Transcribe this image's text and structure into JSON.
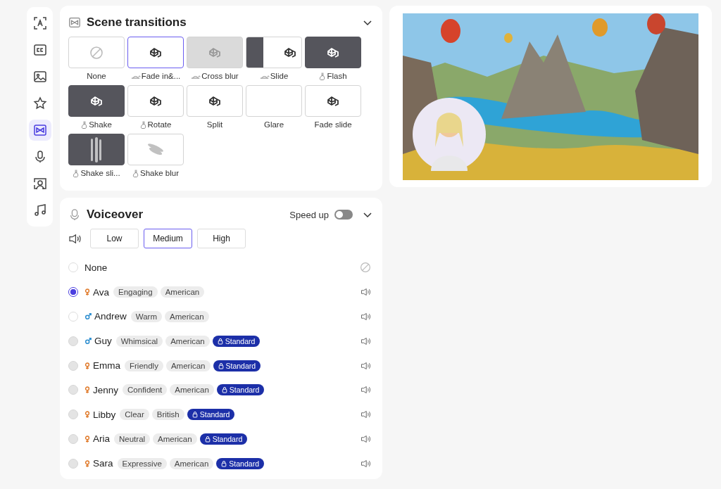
{
  "sidebar": {
    "items": [
      {
        "selected": false
      },
      {
        "selected": false
      },
      {
        "selected": false
      },
      {
        "selected": false
      },
      {
        "selected": true
      },
      {
        "selected": false
      },
      {
        "selected": false
      },
      {
        "selected": false
      }
    ]
  },
  "transitions": {
    "title": "Scene transitions",
    "expanded": true,
    "items": [
      {
        "label": "None",
        "kind": "none",
        "slow": false,
        "fast": false,
        "selected": false
      },
      {
        "label": "Fade in&...",
        "kind": "plain",
        "slow": true,
        "fast": false,
        "selected": true
      },
      {
        "label": "Cross blur",
        "kind": "grey",
        "slow": true,
        "fast": false,
        "selected": false
      },
      {
        "label": "Slide",
        "kind": "slide",
        "slow": true,
        "fast": false,
        "selected": false
      },
      {
        "label": "Flash",
        "kind": "dark",
        "slow": false,
        "fast": true,
        "selected": false
      },
      {
        "label": "Shake",
        "kind": "dark",
        "slow": false,
        "fast": true,
        "selected": false
      },
      {
        "label": "Rotate",
        "kind": "plain",
        "slow": false,
        "fast": true,
        "selected": false
      },
      {
        "label": "Split",
        "kind": "plain",
        "slow": false,
        "fast": false,
        "selected": false
      },
      {
        "label": "Glare",
        "kind": "empty",
        "slow": false,
        "fast": false,
        "selected": false
      },
      {
        "label": "Fade slide",
        "kind": "plain",
        "slow": false,
        "fast": false,
        "selected": false
      },
      {
        "label": "Shake sli...",
        "kind": "blur-dark",
        "slow": false,
        "fast": true,
        "selected": false
      },
      {
        "label": "Shake blur",
        "kind": "blur-light",
        "slow": false,
        "fast": true,
        "selected": false
      }
    ]
  },
  "voiceover": {
    "title": "Voiceover",
    "speed_up": {
      "label": "Speed up",
      "on": false
    },
    "volume": [
      {
        "label": "Low",
        "selected": false
      },
      {
        "label": "Medium",
        "selected": true
      },
      {
        "label": "High",
        "selected": false
      }
    ],
    "voices": [
      {
        "kind": "none",
        "name": "None",
        "selected": false,
        "disabled": false
      },
      {
        "kind": "female",
        "name": "Ava",
        "tags": [
          "Engaging",
          "American"
        ],
        "locked": false,
        "selected": true,
        "disabled": false
      },
      {
        "kind": "male",
        "name": "Andrew",
        "tags": [
          "Warm",
          "American"
        ],
        "locked": false,
        "selected": false,
        "disabled": false
      },
      {
        "kind": "male",
        "name": "Guy",
        "tags": [
          "Whimsical",
          "American"
        ],
        "locked": true,
        "badge": "Standard",
        "selected": false,
        "disabled": true
      },
      {
        "kind": "female",
        "name": "Emma",
        "tags": [
          "Friendly",
          "American"
        ],
        "locked": true,
        "badge": "Standard",
        "selected": false,
        "disabled": true
      },
      {
        "kind": "female",
        "name": "Jenny",
        "tags": [
          "Confident",
          "American"
        ],
        "locked": true,
        "badge": "Standard",
        "selected": false,
        "disabled": true
      },
      {
        "kind": "female",
        "name": "Libby",
        "tags": [
          "Clear",
          "British"
        ],
        "locked": true,
        "badge": "Standard",
        "selected": false,
        "disabled": true
      },
      {
        "kind": "female",
        "name": "Aria",
        "tags": [
          "Neutral",
          "American"
        ],
        "locked": true,
        "badge": "Standard",
        "selected": false,
        "disabled": true
      },
      {
        "kind": "female",
        "name": "Sara",
        "tags": [
          "Expressive",
          "American"
        ],
        "locked": true,
        "badge": "Standard",
        "selected": false,
        "disabled": true
      }
    ]
  }
}
